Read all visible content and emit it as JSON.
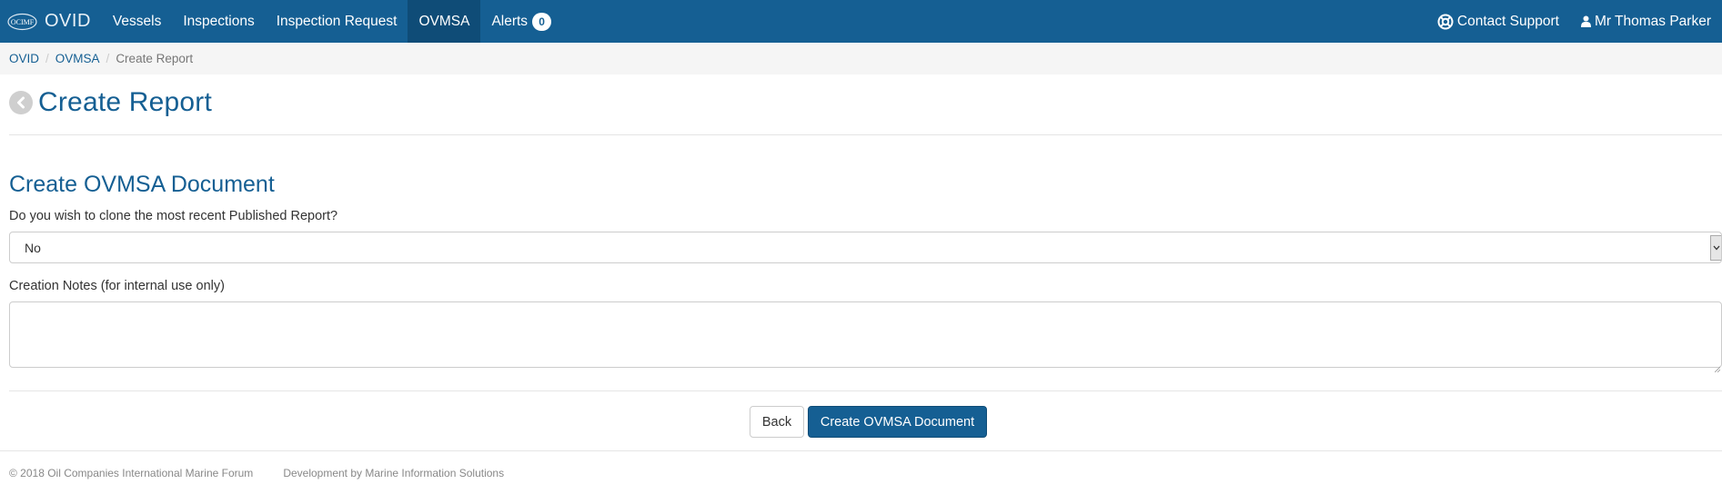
{
  "nav": {
    "brand_logo_text": "OCIMF",
    "brand": "OVID",
    "items": [
      {
        "label": "Vessels"
      },
      {
        "label": "Inspections"
      },
      {
        "label": "Inspection Request"
      },
      {
        "label": "OVMSA"
      },
      {
        "label": "Alerts"
      }
    ],
    "alerts_count": "0",
    "contact_support": "Contact Support",
    "user": "Mr Thomas Parker",
    "colors": {
      "navbar": "#155f93",
      "active": "#0f4c77"
    }
  },
  "breadcrumb": {
    "items": [
      "OVID",
      "OVMSA"
    ],
    "current": "Create Report"
  },
  "page": {
    "title": "Create Report",
    "section_title": "Create OVMSA Document"
  },
  "form": {
    "clone_label": "Do you wish to clone the most recent Published Report?",
    "clone_value": "No",
    "notes_label": "Creation Notes (for internal use only)",
    "notes_value": ""
  },
  "buttons": {
    "back": "Back",
    "create": "Create OVMSA Document"
  },
  "footer": {
    "copyright": "© 2018 Oil Companies International Marine Forum",
    "development": "Development by Marine Information Solutions"
  },
  "icons": {
    "back": "chevron-left-circle-icon",
    "support": "lifebuoy-icon",
    "user": "user-icon",
    "dropdown": "chevron-down-icon"
  }
}
